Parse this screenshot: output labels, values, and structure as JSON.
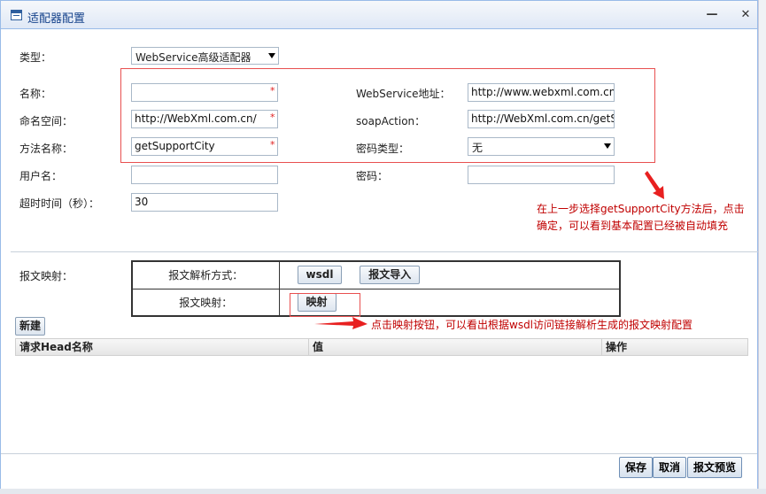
{
  "window": {
    "title": "适配器配置",
    "minimize_symbol": "—",
    "close_symbol": "✕"
  },
  "form": {
    "type_label": "类型：",
    "type_value": "WebService高级适配器",
    "name_label": "名称：",
    "name_value": "",
    "namespace_label": "命名空间：",
    "namespace_value": "http://WebXml.com.cn/",
    "method_label": "方法名称：",
    "method_value": "getSupportCity",
    "user_label": "用户名：",
    "user_value": "",
    "timeout_label": "超时时间（秒）：",
    "timeout_value": "30",
    "ws_addr_label": "WebService地址：",
    "ws_addr_value": "http://www.webxml.com.cn/WebServices/WeatherWebService.asmx?wsdl",
    "soap_label": "soapAction：",
    "soap_value": "http://WebXml.com.cn/getSupportCity",
    "pwd_type_label": "密码类型：",
    "pwd_type_value": "无",
    "pwd_label": "密码：",
    "pwd_value": "",
    "required_mark": "*"
  },
  "annotations": {
    "top_line1": "在上一步选择getSupportCity方法后，点击",
    "top_line2": "确定，可以看到基本配置已经被自动填充",
    "bottom": "点击映射按钮，可以看出根据wsdl访问链接解析生成的报文映射配置"
  },
  "mapping": {
    "section_label": "报文映射：",
    "parse_label": "报文解析方式：",
    "wsdl_button": "wsdl",
    "import_button": "报文导入",
    "map_label": "报文映射：",
    "map_button": "映射"
  },
  "grid": {
    "new_button": "新建",
    "columns": [
      "请求Head名称",
      "值",
      "操作"
    ]
  },
  "footer": {
    "save": "保存",
    "cancel": "取消",
    "preview": "报文预览"
  },
  "colors": {
    "annotation": "#c00000",
    "arrow": "#e82020",
    "required": "#e02020",
    "title": "#15428b"
  }
}
